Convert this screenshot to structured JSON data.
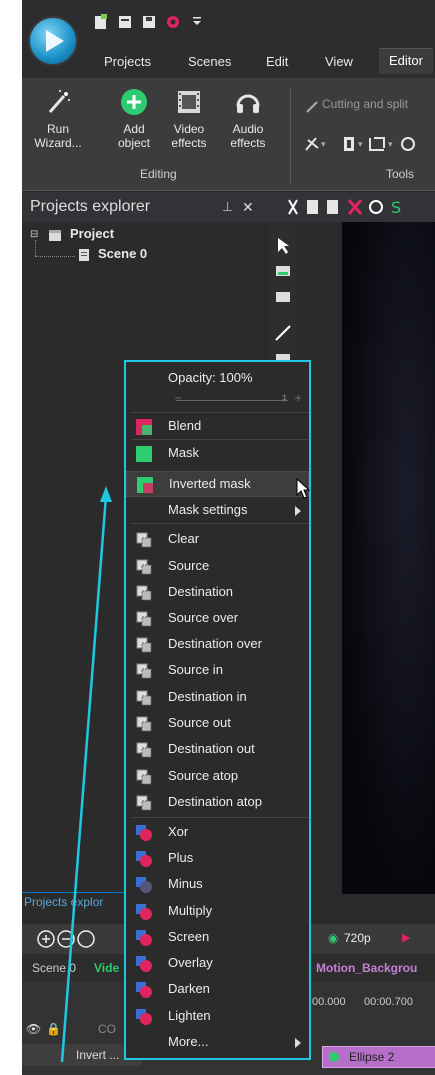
{
  "tabs": [
    "Projects",
    "Scenes",
    "Edit",
    "View",
    "Editor"
  ],
  "ribbon": {
    "run_wizard": "Run Wizard...",
    "add_object": "Add object",
    "video_effects": "Video effects",
    "audio_effects": "Audio effects",
    "editing_label": "Editing",
    "cutting": "Cutting and split",
    "tools_label": "Tools"
  },
  "explorer": {
    "title": "Projects explorer",
    "project": "Project",
    "scene": "Scene 0",
    "bottom_tab": "Projects explor"
  },
  "timeline": {
    "resolution": "720p",
    "scene_tab": "Scene 0",
    "video_tab": "Vide",
    "motion_tab": "Motion_Backgrou",
    "time_a": "00.000",
    "time_b": "00:00.700",
    "layer_label": "CO",
    "invert_label": "Invert ...",
    "ellipse_label": "Ellipse 2"
  },
  "menu": {
    "opacity": "Opacity: 100%",
    "items": [
      {
        "label": "Blend",
        "icon": "blend-icon"
      },
      {
        "label": "Mask",
        "icon": "mask-icon"
      },
      {
        "label": "Inverted mask",
        "icon": "inverted-mask-icon"
      },
      {
        "label": "Mask settings",
        "icon": ""
      },
      {
        "label": "Clear",
        "icon": "clear-icon"
      },
      {
        "label": "Source",
        "icon": "source-icon"
      },
      {
        "label": "Destination",
        "icon": "destination-icon"
      },
      {
        "label": "Source over",
        "icon": "source-over-icon"
      },
      {
        "label": "Destination over",
        "icon": "destination-over-icon"
      },
      {
        "label": "Source in",
        "icon": "source-in-icon"
      },
      {
        "label": "Destination in",
        "icon": "destination-in-icon"
      },
      {
        "label": "Source out",
        "icon": "source-out-icon"
      },
      {
        "label": "Destination out",
        "icon": "destination-out-icon"
      },
      {
        "label": "Source atop",
        "icon": "source-atop-icon"
      },
      {
        "label": "Destination atop",
        "icon": "destination-atop-icon"
      },
      {
        "label": "Xor",
        "icon": "xor-icon"
      },
      {
        "label": "Plus",
        "icon": "plus-icon"
      },
      {
        "label": "Minus",
        "icon": "minus-icon"
      },
      {
        "label": "Multiply",
        "icon": "multiply-icon"
      },
      {
        "label": "Screen",
        "icon": "screen-icon"
      },
      {
        "label": "Overlay",
        "icon": "overlay-icon"
      },
      {
        "label": "Darken",
        "icon": "darken-icon"
      },
      {
        "label": "Lighten",
        "icon": "lighten-icon"
      },
      {
        "label": "More...",
        "icon": ""
      }
    ]
  },
  "colors": {
    "highlight": "#1ec8e0",
    "accent_green": "#2ecc71",
    "red": "#e0245e",
    "blue": "#3a6fd8"
  }
}
